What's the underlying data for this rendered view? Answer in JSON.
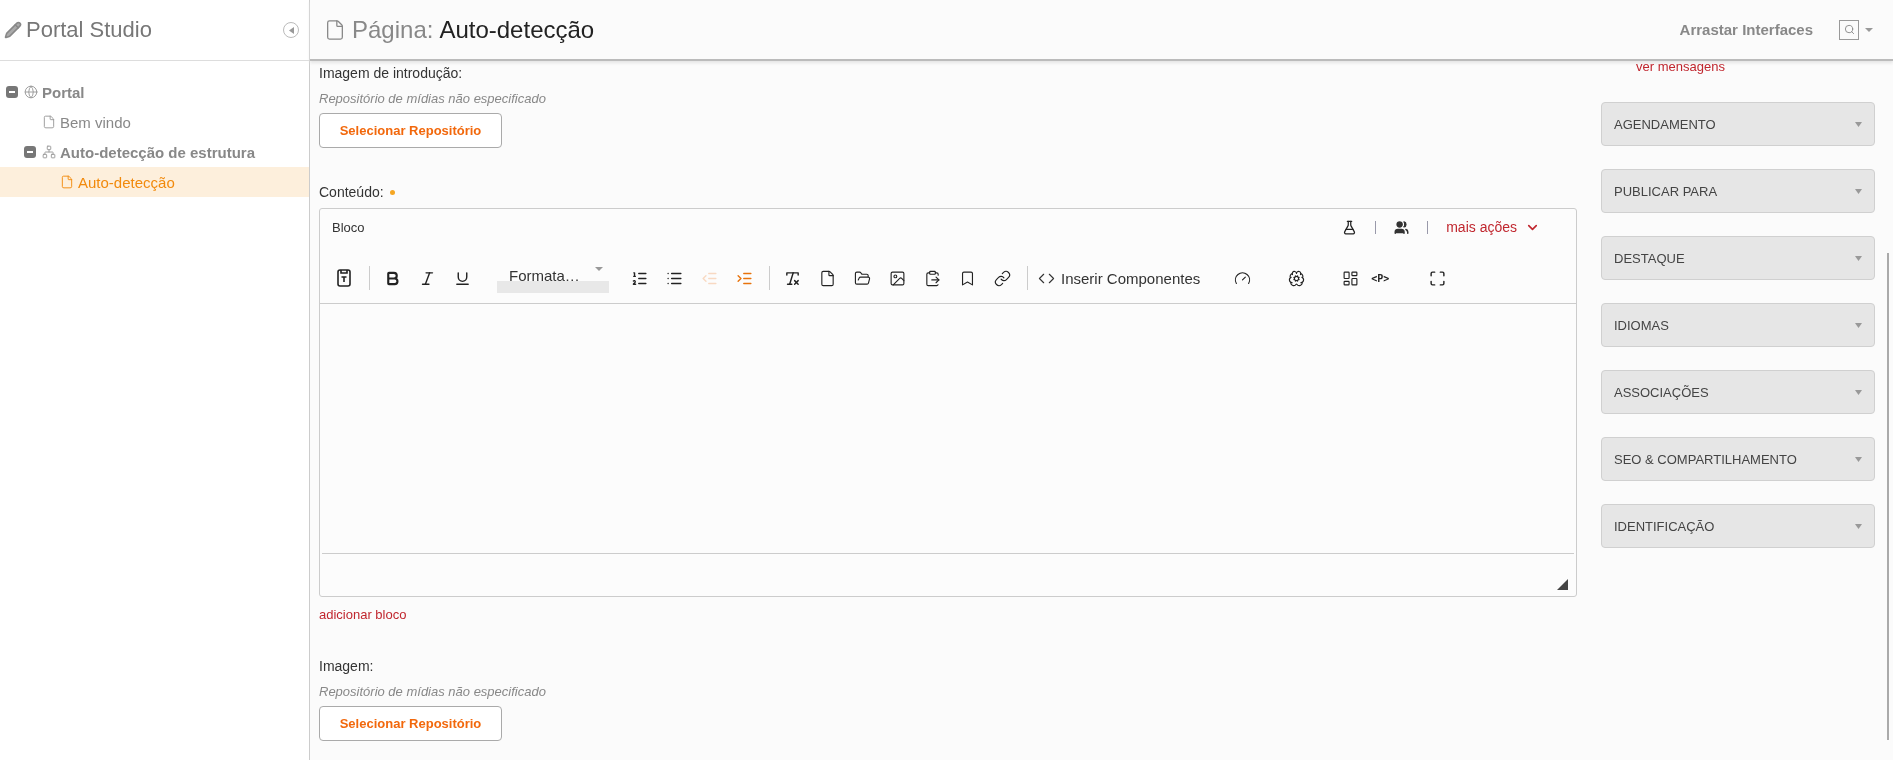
{
  "sidebar": {
    "title": "Portal Studio",
    "tree": [
      {
        "label": "Portal",
        "kind": "site",
        "expanded": true,
        "selected": false,
        "children": [
          {
            "label": "Bem vindo",
            "kind": "page",
            "selected": false
          },
          {
            "label": "Auto-detecção de estrutura",
            "kind": "structure",
            "expanded": true,
            "selected": false,
            "children": [
              {
                "label": "Auto-detecção",
                "kind": "page",
                "selected": true
              }
            ]
          }
        ]
      }
    ]
  },
  "header": {
    "prefix": "Página:",
    "title": "Auto-detecção",
    "action": "Arrastar Interfaces"
  },
  "fields": [
    {
      "kind": "media",
      "label": "Imagem de introdução:",
      "note": "Repositório de mídias não especificado",
      "button": "Selecionar Repositório"
    },
    {
      "kind": "editor",
      "label": "Conteúdo:",
      "required": true,
      "block_title": "Bloco",
      "more_actions": "mais ações",
      "add_link": "adicionar bloco",
      "toolbar": [
        {
          "kind": "template",
          "disabled": false
        },
        {
          "kind": "separator"
        },
        {
          "kind": "bold",
          "disabled": false
        },
        {
          "kind": "italic",
          "disabled": false
        },
        {
          "kind": "underline",
          "disabled": false
        },
        {
          "kind": "format",
          "label": "Formata…",
          "disabled": false
        },
        {
          "kind": "ordered-list",
          "disabled": false
        },
        {
          "kind": "bullet-list",
          "disabled": false
        },
        {
          "kind": "outdent",
          "disabled": true
        },
        {
          "kind": "indent",
          "disabled": false
        },
        {
          "kind": "separator"
        },
        {
          "kind": "clear-format",
          "disabled": false
        },
        {
          "kind": "page",
          "disabled": false
        },
        {
          "kind": "folder",
          "disabled": false
        },
        {
          "kind": "image",
          "disabled": false
        },
        {
          "kind": "paste",
          "disabled": false
        },
        {
          "kind": "bookmark",
          "disabled": false
        },
        {
          "kind": "link",
          "disabled": false
        },
        {
          "kind": "separator"
        },
        {
          "kind": "components",
          "label": "Inserir Componentes",
          "disabled": false
        },
        {
          "kind": "gauge",
          "disabled": false
        },
        {
          "kind": "brain",
          "disabled": false
        },
        {
          "kind": "layout",
          "disabled": false
        },
        {
          "kind": "tag",
          "label": "<P>",
          "disabled": false
        },
        {
          "kind": "fullscreen",
          "disabled": false
        }
      ]
    },
    {
      "kind": "media",
      "label": "Imagem:",
      "note": "Repositório de mídias não especificado",
      "button": "Selecionar Repositório"
    }
  ],
  "side_panel": {
    "messages_link": "ver mensagens",
    "sections": [
      {
        "label": "AGENDAMENTO",
        "expanded": false
      },
      {
        "label": "PUBLICAR PARA",
        "expanded": false
      },
      {
        "label": "DESTAQUE",
        "expanded": false
      },
      {
        "label": "IDIOMAS",
        "expanded": false
      },
      {
        "label": "ASSOCIAÇÕES",
        "expanded": false
      },
      {
        "label": "SEO & COMPARTILHAMENTO",
        "expanded": false
      },
      {
        "label": "IDENTIFICAÇÃO",
        "expanded": false
      }
    ]
  }
}
